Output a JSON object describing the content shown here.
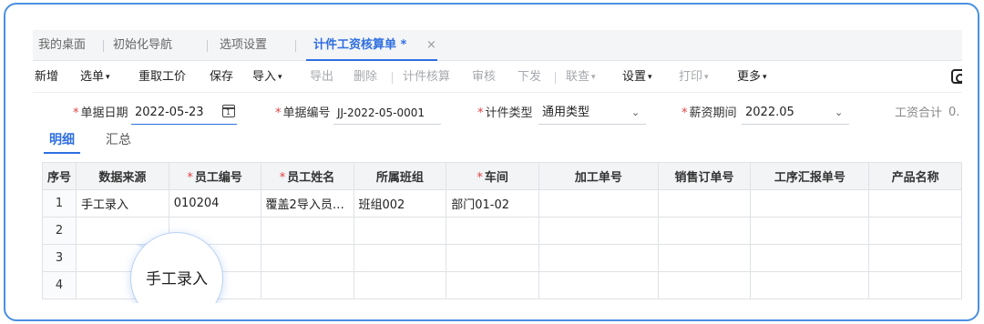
{
  "tabs": [
    {
      "label": "我的桌面"
    },
    {
      "label": "初始化导航"
    },
    {
      "label": "选项设置"
    },
    {
      "label": "计件工资核算单 *"
    }
  ],
  "tab_close": "×",
  "toolbar": {
    "items": [
      {
        "label": "新增",
        "enabled": true,
        "dropdown": false
      },
      {
        "label": "选单",
        "enabled": true,
        "dropdown": true
      },
      {
        "label": "重取工价",
        "enabled": true,
        "dropdown": false
      },
      {
        "label": "保存",
        "enabled": true,
        "dropdown": false
      },
      {
        "label": "导入",
        "enabled": true,
        "dropdown": true
      },
      {
        "label": "导出",
        "enabled": false,
        "dropdown": false
      },
      {
        "label": "删除",
        "enabled": false,
        "dropdown": false
      },
      {
        "label": "计件核算",
        "enabled": false,
        "dropdown": false
      },
      {
        "label": "审核",
        "enabled": false,
        "dropdown": false
      },
      {
        "label": "下发",
        "enabled": false,
        "dropdown": false
      },
      {
        "label": "联查",
        "enabled": false,
        "dropdown": true
      },
      {
        "label": "设置",
        "enabled": true,
        "dropdown": true
      },
      {
        "label": "打印",
        "enabled": false,
        "dropdown": true
      },
      {
        "label": "更多",
        "enabled": true,
        "dropdown": true
      }
    ],
    "caret": "▾"
  },
  "form": {
    "date_label": "单据日期",
    "date_value": "2022-05-23",
    "number_label": "单据编号",
    "number_value": "JJ-2022-05-0001",
    "type_label": "计件类型",
    "type_value": "通用类型",
    "period_label": "薪资期间",
    "period_value": "2022.05",
    "total_label": "工资合计",
    "total_value": "0.",
    "required_mark": "*",
    "chevron": "⌄"
  },
  "subtabs": [
    {
      "label": "明细"
    },
    {
      "label": "汇总"
    }
  ],
  "table": {
    "columns": [
      {
        "label": "序号",
        "required": false
      },
      {
        "label": "数据来源",
        "required": false
      },
      {
        "label": "员工编号",
        "required": true
      },
      {
        "label": "员工姓名",
        "required": true
      },
      {
        "label": "所属班组",
        "required": false
      },
      {
        "label": "车间",
        "required": true
      },
      {
        "label": "加工单号",
        "required": false
      },
      {
        "label": "销售订单号",
        "required": false
      },
      {
        "label": "工序汇报单号",
        "required": false
      },
      {
        "label": "产品名称",
        "required": false
      }
    ],
    "rows": [
      [
        "1",
        "手工录入",
        "010204",
        "覆盖2导入员…",
        "班组002",
        "部门01-02",
        "",
        "",
        "",
        ""
      ],
      [
        "2",
        "",
        "",
        "",
        "",
        "",
        "",
        "",
        "",
        ""
      ],
      [
        "3",
        "",
        "",
        "",
        "",
        "",
        "",
        "",
        "",
        ""
      ],
      [
        "4",
        "",
        "",
        "",
        "",
        "",
        "",
        "",
        "",
        ""
      ]
    ]
  },
  "magnifier_text": "手工录入",
  "colors": {
    "accent": "#2f6fe0",
    "frame_border": "#4a90e2",
    "required": "#e04040",
    "disabled_text": "#a6a9ad"
  }
}
